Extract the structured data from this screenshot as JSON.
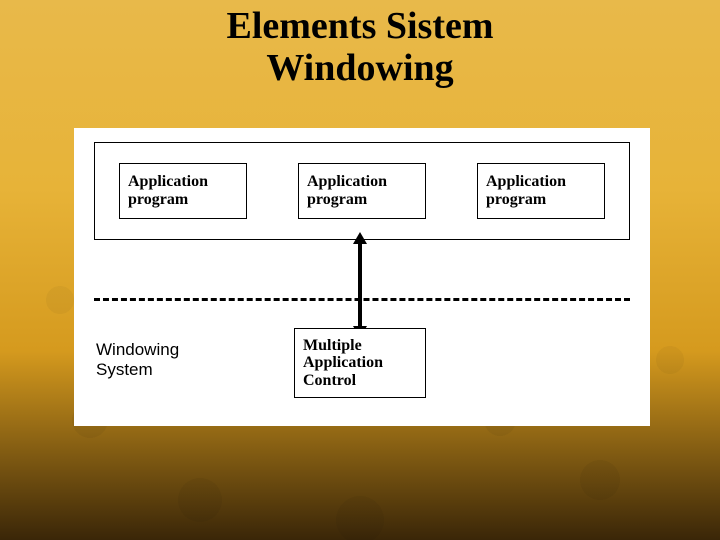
{
  "title": "Elements Sistem\nWindowing",
  "diagram": {
    "apps": [
      "Application\nprogram",
      "Application\nprogram",
      "Application\nprogram"
    ],
    "mac": "Multiple\nApplication\nControl",
    "ws_label": "Windowing\nSystem"
  }
}
